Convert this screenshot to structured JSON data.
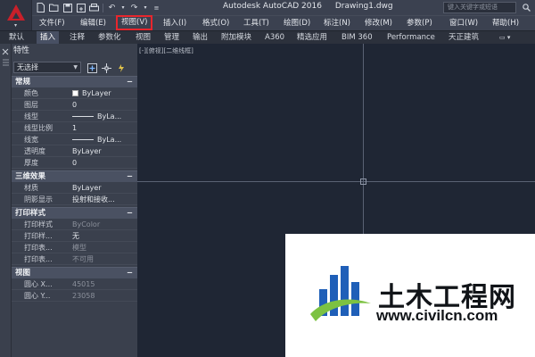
{
  "window": {
    "app_title": "Autodesk AutoCAD 2016",
    "file_name": "Drawing1.dwg",
    "search_placeholder": "键入关键字或短语"
  },
  "menubar": {
    "items": [
      {
        "label": "文件(F)"
      },
      {
        "label": "编辑(E)"
      },
      {
        "label": "视图(V)",
        "highlighted": true
      },
      {
        "label": "插入(I)"
      },
      {
        "label": "格式(O)"
      },
      {
        "label": "工具(T)"
      },
      {
        "label": "绘图(D)"
      },
      {
        "label": "标注(N)"
      },
      {
        "label": "修改(M)"
      },
      {
        "label": "参数(P)"
      },
      {
        "label": "窗口(W)"
      },
      {
        "label": "帮助(H)"
      }
    ]
  },
  "ribbon": {
    "tabs": [
      {
        "label": "默认"
      },
      {
        "label": "插入",
        "active": true
      },
      {
        "label": "注释"
      },
      {
        "label": "参数化"
      },
      {
        "label": "视图"
      },
      {
        "label": "管理"
      },
      {
        "label": "输出"
      },
      {
        "label": "附加模块"
      },
      {
        "label": "A360"
      },
      {
        "label": "精选应用"
      },
      {
        "label": "BIM 360"
      },
      {
        "label": "Performance"
      },
      {
        "label": "天正建筑"
      }
    ],
    "options_glyph": "▭ ▾"
  },
  "properties": {
    "title": "特性",
    "selection": "无选择",
    "sections": [
      {
        "title": "常规",
        "rows": [
          {
            "name": "颜色",
            "value": "ByLayer"
          },
          {
            "name": "图层",
            "value": "0"
          },
          {
            "name": "线型",
            "value": "ByLa..."
          },
          {
            "name": "线型比例",
            "value": "1"
          },
          {
            "name": "线宽",
            "value": "ByLa..."
          },
          {
            "name": "透明度",
            "value": "ByLayer"
          },
          {
            "name": "厚度",
            "value": "0"
          }
        ]
      },
      {
        "title": "三维效果",
        "rows": [
          {
            "name": "材质",
            "value": "ByLayer"
          },
          {
            "name": "阴影显示",
            "value": "投射和接收..."
          }
        ]
      },
      {
        "title": "打印样式",
        "rows": [
          {
            "name": "打印样式",
            "value": "ByColor"
          },
          {
            "name": "打印样...",
            "value": "无"
          },
          {
            "name": "打印表...",
            "value": "模型"
          },
          {
            "name": "打印表...",
            "value": "不可用"
          }
        ]
      },
      {
        "title": "视图",
        "rows": [
          {
            "name": "圆心 X...",
            "value": "45015"
          },
          {
            "name": "圆心 Y...",
            "value": "23058"
          }
        ]
      }
    ]
  },
  "viewport": {
    "label": "[-][俯视][二维线框]"
  },
  "watermark": {
    "cn_text": "土木工程网",
    "url": "www.civilcn.com"
  },
  "colors": {
    "highlight_box": "#e8262d",
    "autocad_red": "#c8202a",
    "canvas_bg": "#1f2634",
    "watermark_blue": "#1f5fb8",
    "watermark_green": "#7cc242"
  }
}
